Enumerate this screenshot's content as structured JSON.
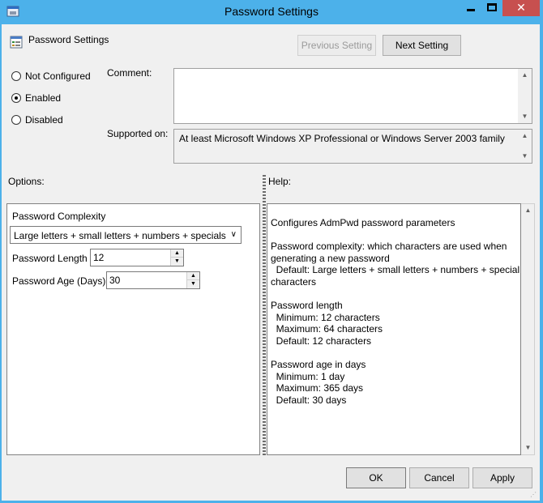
{
  "window": {
    "title": "Password Settings",
    "close_glyph": "✕",
    "colors": {
      "chrome": "#4cb1ea",
      "close": "#c7504f",
      "client": "#f0f0f0"
    }
  },
  "header": {
    "title": "Password Settings",
    "previous_label": "Previous Setting",
    "next_label": "Next Setting"
  },
  "state": {
    "options": [
      {
        "label": "Not Configured",
        "selected": false
      },
      {
        "label": "Enabled",
        "selected": true
      },
      {
        "label": "Disabled",
        "selected": false
      }
    ]
  },
  "comment": {
    "label": "Comment:",
    "value": ""
  },
  "supported": {
    "label": "Supported on:",
    "value": "At least Microsoft Windows XP Professional or Windows Server 2003 family"
  },
  "options_pane": {
    "label": "Options:",
    "complexity_label": "Password Complexity",
    "complexity_value": "Large letters + small letters + numbers + specials",
    "length_label": "Password Length",
    "length_value": "12",
    "age_label": "Password Age (Days)",
    "age_value": "30"
  },
  "help_pane": {
    "label": "Help:",
    "text": "Configures AdmPwd password parameters\n\nPassword complexity: which characters are used when\ngenerating a new password\n  Default: Large letters + small letters + numbers + special\ncharacters\n\nPassword length\n  Minimum: 12 characters\n  Maximum: 64 characters\n  Default: 12 characters\n\nPassword age in days\n  Minimum: 1 day\n  Maximum: 365 days\n  Default: 30 days"
  },
  "footer": {
    "ok_label": "OK",
    "cancel_label": "Cancel",
    "apply_label": "Apply"
  },
  "icons": {
    "title": "policy-window-icon",
    "header": "policy-setting-icon",
    "scroll_up": "▲",
    "scroll_down": "▼",
    "combo_arrow": "∨"
  }
}
